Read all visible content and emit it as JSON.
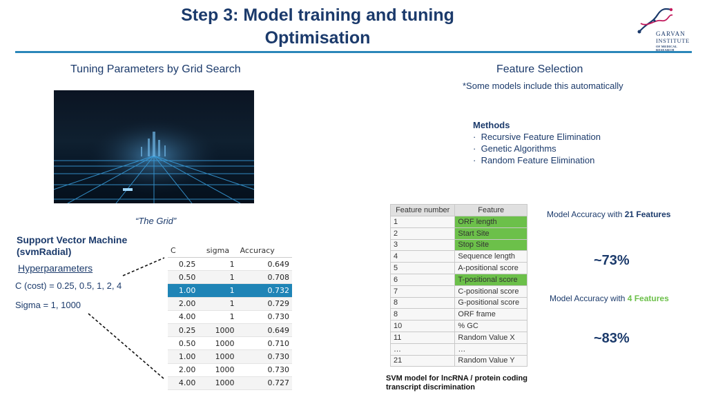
{
  "header": {
    "title_line1": "Step 3: Model training and tuning",
    "title_line2": "Optimisation",
    "logo": {
      "line1": "GARVAN",
      "line2": "INSTITUTE",
      "line3": "OF MEDICAL RESEARCH",
      "accent": "#c2185b"
    }
  },
  "left": {
    "heading": "Tuning Parameters by Grid Search",
    "image_caption": "“The Grid”",
    "svm_title_line1": "Support Vector Machine",
    "svm_title_line2": "(svmRadial)",
    "hyper_label": "Hyperparameters",
    "c_cost": "C (cost) = 0.25, 0.5, 1, 2, 4",
    "sigma": "Sigma = 1, 1000",
    "tuning_table": {
      "headers": [
        "C",
        "sigma",
        "Accuracy"
      ],
      "rows": [
        [
          "0.25",
          "1",
          "0.649"
        ],
        [
          "0.50",
          "1",
          "0.708"
        ],
        [
          "1.00",
          "1",
          "0.732"
        ],
        [
          "2.00",
          "1",
          "0.729"
        ],
        [
          "4.00",
          "1",
          "0.730"
        ],
        [
          "0.25",
          "1000",
          "0.649"
        ],
        [
          "0.50",
          "1000",
          "0.710"
        ],
        [
          "1.00",
          "1000",
          "0.730"
        ],
        [
          "2.00",
          "1000",
          "0.730"
        ],
        [
          "4.00",
          "1000",
          "0.727"
        ]
      ],
      "highlight_row": 2,
      "highlight_color": "#1f84b6"
    }
  },
  "right": {
    "heading": "Feature Selection",
    "note": "*Some models include this automatically",
    "methods_title": "Methods",
    "methods": [
      "Recursive Feature Elimination",
      "Genetic Algorithms",
      "Random Feature Elimination"
    ],
    "feature_table": {
      "headers": [
        "Feature number",
        "Feature"
      ],
      "rows": [
        [
          "1",
          "ORF length"
        ],
        [
          "2",
          "Start Site"
        ],
        [
          "3",
          "Stop Site"
        ],
        [
          "4",
          "Sequence length"
        ],
        [
          "5",
          "A-positional score"
        ],
        [
          "6",
          "T-positional score"
        ],
        [
          "7",
          "C-positional score"
        ],
        [
          "8",
          "G-positional score"
        ],
        [
          "8",
          "ORF frame"
        ],
        [
          "10",
          "% GC"
        ],
        [
          "11",
          "Random Value X"
        ],
        [
          "…",
          "…"
        ],
        [
          "21",
          "Random Value Y"
        ]
      ],
      "green_rows": [
        0,
        1,
        2,
        5
      ],
      "green_color": "#6cc04a"
    },
    "acc21_prefix": "Model Accuracy with ",
    "acc21_num": "21 Features",
    "acc21_value": "~73%",
    "acc4_prefix": "Model Accuracy with ",
    "acc4_num": "4 Features",
    "acc4_value": "~83%",
    "acc4_color": "#6cc04a",
    "svm_note_line1": "SVM model for lncRNA / protein coding",
    "svm_note_line2": "transcript discrimination"
  }
}
